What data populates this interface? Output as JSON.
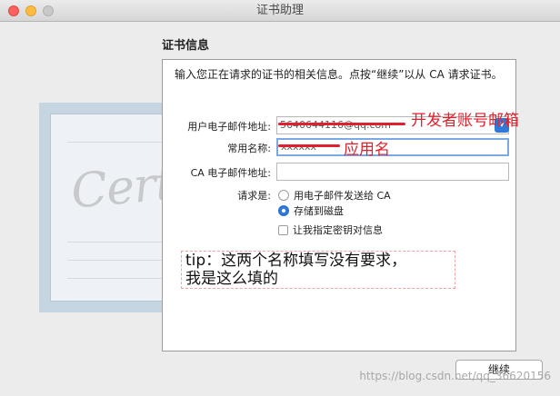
{
  "window": {
    "title": "证书助理"
  },
  "section": {
    "heading": "证书信息",
    "intro": "输入您正在请求的证书的相关信息。点按“继续”以从 CA 请求证书。"
  },
  "form": {
    "email_label": "用户电子邮件地址:",
    "email_value": "5640644116@qq.com",
    "common_name_label": "常用名称:",
    "common_name_value": "xxxxxx",
    "ca_email_label": "CA 电子邮件地址:",
    "ca_email_value": "",
    "request_label": "请求是:",
    "options": [
      {
        "label": "用电子邮件发送给 CA",
        "selected": false
      },
      {
        "label": "存储到磁盘",
        "selected": true
      }
    ],
    "keypair_label": "让我指定密钥对信息",
    "keypair_checked": false
  },
  "annotations": {
    "email_note": "开发者账号邮箱",
    "name_note": "应用名",
    "tip": "tip：这两个名称填写没有要求，\n我是这么填的"
  },
  "buttons": {
    "continue": "继续"
  },
  "watermark": "https://blog.csdn.net/qq_36620156",
  "certificate_art": {
    "word": "Certificate"
  },
  "colors": {
    "accent": "#2f79d8",
    "annotation": "#e0202c",
    "focus_ring": "#7aaae4"
  },
  "icons": {
    "dropdown": "chevron-down-icon"
  }
}
